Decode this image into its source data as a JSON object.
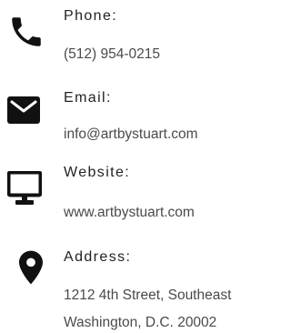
{
  "contact": {
    "phone": {
      "icon": "phone-icon",
      "label": "Phone:",
      "value": "(512) 954-0215"
    },
    "email": {
      "icon": "envelope-icon",
      "label": "Email:",
      "value": "info@artbystuart.com"
    },
    "website": {
      "icon": "monitor-icon",
      "label": "Website:",
      "value": "www.artbystuart.com"
    },
    "address": {
      "icon": "map-pin-icon",
      "label": "Address:",
      "line1": "1212 4th Street, Southeast",
      "line2": "Washington, D.C. 20002"
    }
  },
  "colors": {
    "icon": "#111111",
    "label": "#222222",
    "value": "#4a4a4a",
    "background": "#ffffff"
  }
}
